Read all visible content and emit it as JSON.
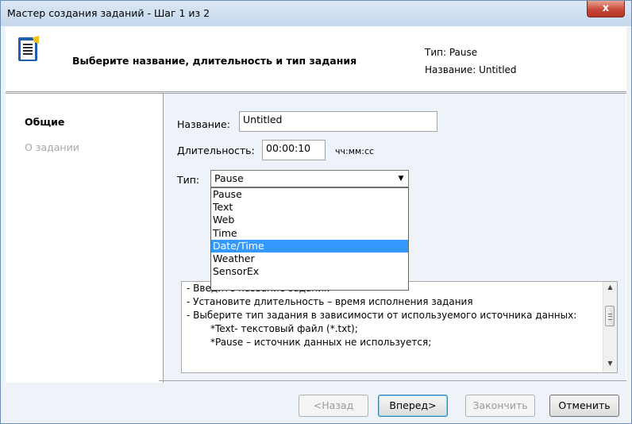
{
  "window": {
    "title": "Мастер создания заданий - Шаг 1 из 2",
    "close_label": "x"
  },
  "header": {
    "title": "Выберите название, длительность и тип задания",
    "type_info": "Тип: Pause",
    "name_info": "Название: Untitled"
  },
  "sidebar": {
    "items": [
      {
        "label": "Общие",
        "active": true
      },
      {
        "label": "О задании",
        "active": false
      }
    ]
  },
  "form": {
    "name_label": "Название:",
    "name_value": "Untitled",
    "duration_label": "Длительность:",
    "duration_value": "00:00:10",
    "duration_hint": "чч:мм:сс",
    "type_label": "Тип:",
    "type_value": "Pause",
    "type_options": [
      "Pause",
      "Text",
      "Web",
      "Time",
      "Date/Time",
      "Weather",
      "SensorEx"
    ],
    "highlighted_option": "Date/Time"
  },
  "info": {
    "lines": [
      "- Введите название задания",
      "- Установите длительность – время исполнения задания",
      "- Выберите тип задания в зависимости от используемого источника данных:",
      "*Text- текстовый файл (*.txt);",
      "*Pause – источник данных не используется;"
    ]
  },
  "buttons": {
    "back": "<Назад",
    "next": "Вперед>",
    "finish": "Закончить",
    "cancel": "Отменить"
  },
  "colors": {
    "selection": "#3399ff",
    "window_border": "#6d8fb5",
    "close_button": "#c9493a"
  }
}
